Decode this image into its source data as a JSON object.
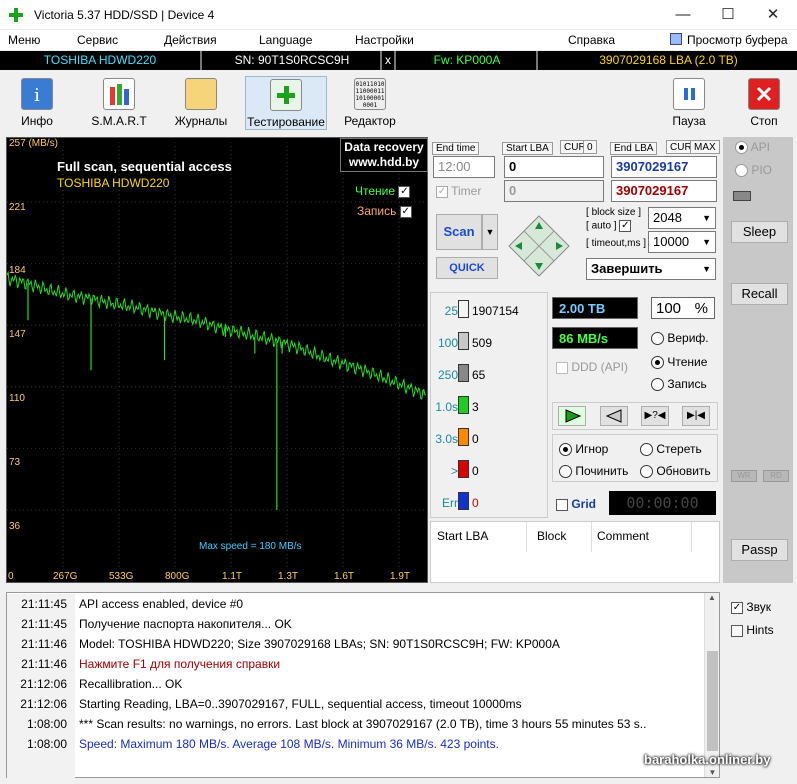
{
  "window": {
    "title": "Victoria 5.37 HDD/SSD | Device 4",
    "min": "—",
    "max": "☐",
    "close": "✕"
  },
  "menu": {
    "items": [
      "Меню",
      "Сервис",
      "Действия",
      "Language",
      "Настройки"
    ],
    "help": "Справка",
    "buffer": "Просмотр буфера"
  },
  "infobar": {
    "model": "TOSHIBA HDWD220",
    "sn": "SN: 90T1S0RCSC9H",
    "x": "x",
    "fw": "Fw: KP000A",
    "lba": "3907029168 LBA (2.0 TB)"
  },
  "toolbar": {
    "info": "Инфо",
    "smart": "S.M.A.R.T",
    "logs": "Журналы",
    "test": "Тестирование",
    "editor": "Редактор",
    "pause": "Пауза",
    "stop": "Стоп",
    "editor_bits": "01011010\n11000011\n10100001\n0001"
  },
  "graph": {
    "y_unit": "257 (MB/s)",
    "title": "Full scan, sequential access",
    "device": "TOSHIBA HDWD220",
    "dr1": "Data recovery",
    "dr2": "www.hdd.by",
    "read": "Чтение",
    "write": "Запись",
    "max_speed": "Max speed = 180 MB/s",
    "yticks": [
      "221",
      "184",
      "147",
      "110",
      "73",
      "36"
    ],
    "xticks": [
      "0",
      "267G",
      "533G",
      "800G",
      "1.1T",
      "1.3T",
      "1.6T",
      "1.9T"
    ]
  },
  "chart_data": {
    "type": "line",
    "x_unit": "TB",
    "y_unit": "MB/s",
    "ylim": [
      0,
      257
    ],
    "series": [
      {
        "name": "Чтение",
        "x": [
          0,
          0.1,
          0.2,
          0.3,
          0.4,
          0.5,
          0.6,
          0.7,
          0.8,
          0.9,
          1.0,
          1.1,
          1.2,
          1.3,
          1.4,
          1.5,
          1.6,
          1.7,
          1.8,
          1.9,
          2.0
        ],
        "y": [
          175,
          172,
          168,
          165,
          163,
          160,
          158,
          155,
          152,
          150,
          146,
          143,
          140,
          137,
          133,
          128,
          124,
          120,
          115,
          110,
          105
        ]
      }
    ]
  },
  "scan": {
    "end_time_lbl": "End time",
    "start_lba_lbl": "Start LBA",
    "cur": "CUR",
    "zero": "0",
    "end_lba_lbl": "End LBA",
    "max": "MAX",
    "time_val": "12:00",
    "start_val": "0",
    "end_val": "3907029167",
    "timer_lbl": "Timer",
    "timer_val": "0",
    "end_val2": "3907029167",
    "scan_btn": "Scan",
    "quick_btn": "QUICK",
    "block_size_lbl": "block size",
    "auto_lbl": "auto",
    "timeout_lbl": "timeout,ms",
    "block_size": "2048",
    "timeout": "10000",
    "finish": "Завершить"
  },
  "counters": [
    {
      "label": "25",
      "value": "1907154",
      "color": "#f4f4f4"
    },
    {
      "label": "100",
      "value": "509",
      "color": "#c8c8c8"
    },
    {
      "label": "250",
      "value": "65",
      "color": "#888888"
    },
    {
      "label": "1.0s",
      "value": "3",
      "color": "#22cc22"
    },
    {
      "label": "3.0s",
      "value": "0",
      "color": "#ff8800"
    },
    {
      "label": ">",
      "value": "0",
      "color": "#dd0000"
    },
    {
      "label": "Err",
      "value": "0",
      "color": "#1133cc"
    }
  ],
  "status": {
    "size": "2.00 TB",
    "percent": "100",
    "pct_sign": "%",
    "speed": "86 MB/s",
    "ddd": "DDD (API)",
    "verify": "Вериф.",
    "read": "Чтение",
    "write": "Запись",
    "ignore": "Игнор",
    "erase": "Стереть",
    "repair": "Починить",
    "refresh": "Обновить",
    "grid": "Grid",
    "timer": "00:00:00"
  },
  "table": {
    "col1": "Start LBA",
    "col2": "Block",
    "col3": "Comment"
  },
  "side": {
    "api": "API",
    "pio": "PIO",
    "sleep": "Sleep",
    "recall": "Recall",
    "wr": "WR",
    "rd": "RD",
    "passp": "Passp"
  },
  "log": [
    {
      "t": "21:11:45",
      "m": "API access enabled, device #0",
      "c": "#000"
    },
    {
      "t": "21:11:45",
      "m": "Получение паспорта накопителя... OK",
      "c": "#000"
    },
    {
      "t": "21:11:46",
      "m": "Model: TOSHIBA HDWD220; Size 3907029168 LBAs; SN: 90T1S0RCSC9H; FW: KP000A",
      "c": "#000"
    },
    {
      "t": "21:11:46",
      "m": "Нажмите F1 для получения справки",
      "c": "#a00000"
    },
    {
      "t": "21:12:06",
      "m": "Recallibration... OK",
      "c": "#000"
    },
    {
      "t": "21:12:06",
      "m": "Starting Reading, LBA=0..3907029167, FULL, sequential access, timeout 10000ms",
      "c": "#000"
    },
    {
      "t": "1:08:00",
      "m": "*** Scan results: no warnings, no errors. Last block at 3907029167 (2.0 TB), time 3 hours 55 minutes 53 s..",
      "c": "#000"
    },
    {
      "t": "1:08:00",
      "m": "Speed: Maximum 180 MB/s. Average 108 MB/s. Minimum 36 MB/s. 423 points.",
      "c": "#1a2dc0"
    }
  ],
  "opts": {
    "sound": "Звук",
    "hints": "Hints"
  },
  "watermark": "baraholka.onliner.by"
}
